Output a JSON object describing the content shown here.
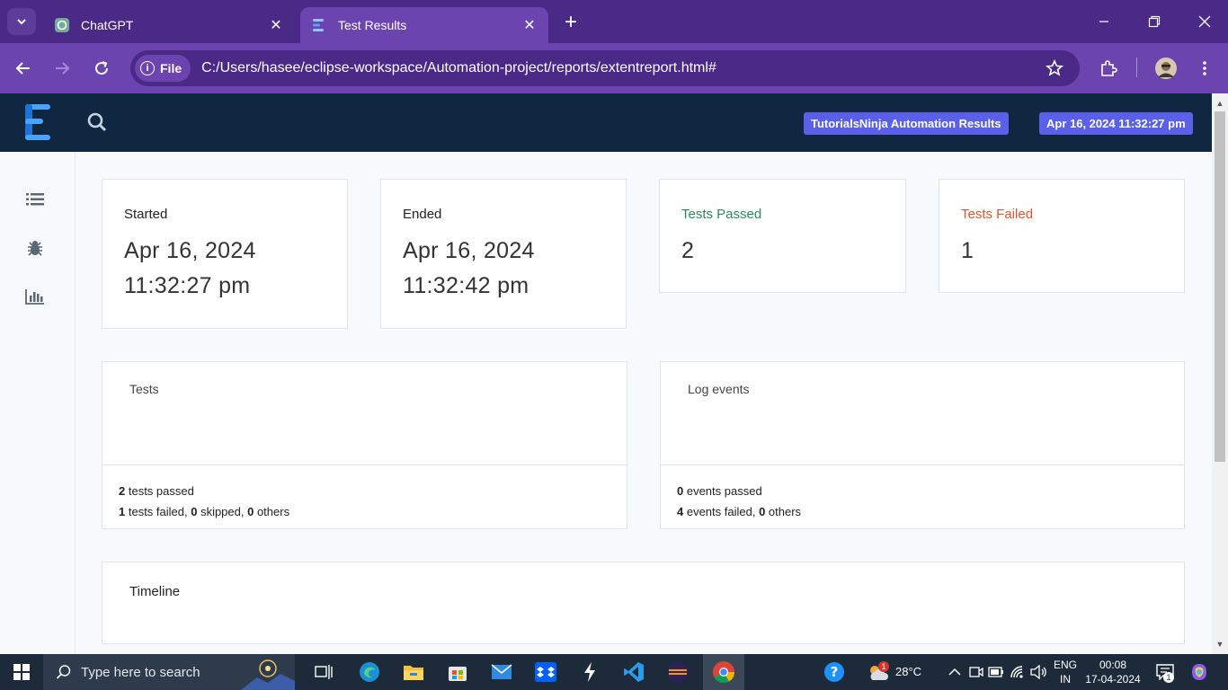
{
  "browser": {
    "tabs": [
      {
        "title": "ChatGPT",
        "active": false
      },
      {
        "title": "Test Results",
        "active": true
      }
    ],
    "scheme_label": "File",
    "url": "C:/Users/hasee/eclipse-workspace/Automation-project/reports/extentreport.html#"
  },
  "header": {
    "report_name": "TutorialsNinja Automation Results",
    "report_date": "Apr 16, 2024 11:32:27 pm"
  },
  "sidebar": {
    "items": [
      {
        "icon": "list-icon"
      },
      {
        "icon": "bug-icon"
      },
      {
        "icon": "bar-chart-icon"
      }
    ]
  },
  "kpis": {
    "started": {
      "label": "Started",
      "date": "Apr 16, 2024",
      "time": "11:32:27 pm"
    },
    "ended": {
      "label": "Ended",
      "date": "Apr 16, 2024",
      "time": "11:32:42 pm"
    },
    "passed": {
      "label": "Tests Passed",
      "value": "2"
    },
    "failed": {
      "label": "Tests Failed",
      "value": "1"
    }
  },
  "tests_card": {
    "title": "Tests",
    "passed_count": "2",
    "passed_text": " tests passed",
    "failed_count": "1",
    "failed_text": " tests failed, ",
    "skipped_count": "0",
    "skipped_text": " skipped, ",
    "others_count": "0",
    "others_text": " others"
  },
  "log_card": {
    "title": "Log events",
    "passed_count": "0",
    "passed_text": " events passed",
    "failed_count": "4",
    "failed_text": " events failed, ",
    "others_count": "0",
    "others_text": " others"
  },
  "timeline": {
    "title": "Timeline"
  },
  "taskbar": {
    "search_placeholder": "Type here to search",
    "weather": "28°C",
    "weather_badge": "1",
    "lang_line1": "ENG",
    "lang_line2": "IN",
    "time": "00:08",
    "date": "17-04-2024",
    "notif_count": "1"
  },
  "colors": {
    "header_bg": "#0f2740",
    "badge_bg": "#5b60e8",
    "pass": "#2c8a59",
    "fail": "#e0552f",
    "browser_frame": "#4a2a86"
  }
}
